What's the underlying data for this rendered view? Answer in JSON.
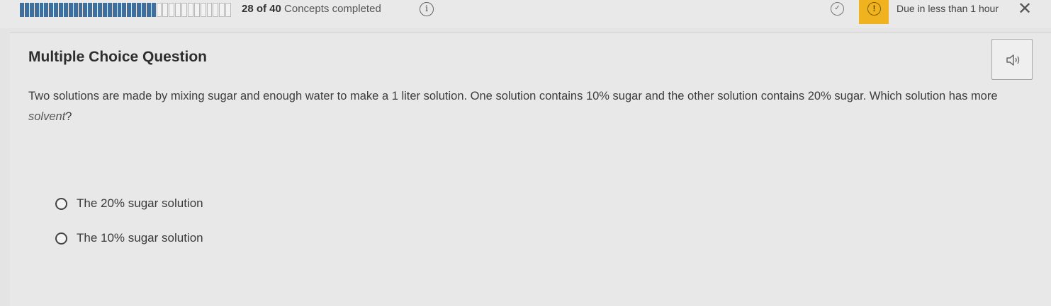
{
  "progress": {
    "completed": 28,
    "total": 40,
    "count_text": "28 of 40",
    "label": " Concepts completed",
    "accent_color": "#3f6f9a"
  },
  "header": {
    "info_icon": "info-icon",
    "info_glyph": "i",
    "check_icon": "check-circle-icon",
    "check_glyph": "✓",
    "alert_icon": "alert-icon",
    "alert_glyph": "!",
    "alert_color": "#f0b31f",
    "due_text": "Due in less than 1 hour",
    "close_glyph": "✕"
  },
  "question": {
    "type_label": "Multiple Choice Question",
    "audio_icon": "speaker-icon",
    "text_part1": "Two solutions are made by mixing sugar and enough water to make a 1 liter solution. One solution contains 10% sugar and the other solution contains 20% sugar. Which solution has more ",
    "text_emphasis": "solvent",
    "text_part2": "?",
    "options": [
      {
        "label": "The 20% sugar solution",
        "selected": false
      },
      {
        "label": "The 10% sugar solution",
        "selected": false
      }
    ]
  }
}
